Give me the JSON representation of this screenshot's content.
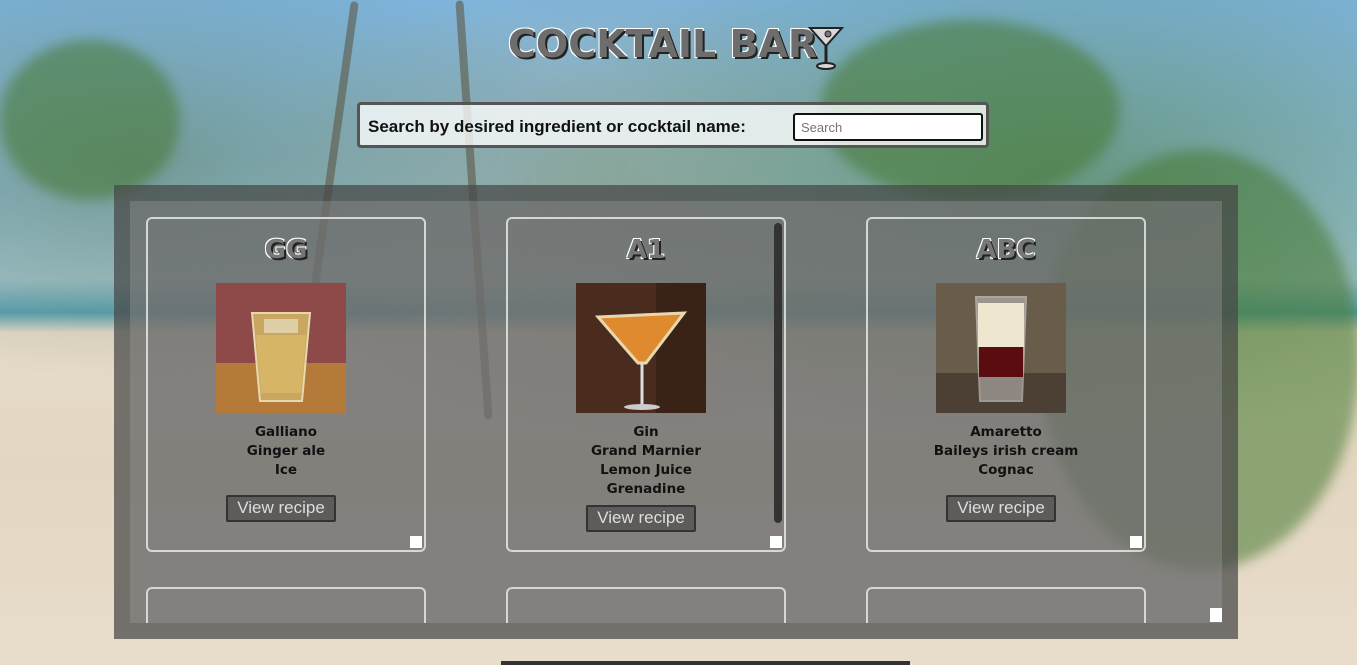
{
  "header": {
    "title": "COCKTAIL BAR"
  },
  "search": {
    "label": "Search by desired ingredient or cocktail name:",
    "placeholder": "Search"
  },
  "cocktails": [
    {
      "name": "GG",
      "ingredients": [
        "Galliano",
        "Ginger ale",
        "Ice"
      ],
      "button": "View recipe"
    },
    {
      "name": "A1",
      "ingredients": [
        "Gin",
        "Grand Marnier",
        "Lemon Juice",
        "Grenadine"
      ],
      "button": "View recipe"
    },
    {
      "name": "ABC",
      "ingredients": [
        "Amaretto",
        "Baileys irish cream",
        "Cognac"
      ],
      "button": "View recipe"
    }
  ],
  "colors": {
    "accent_scrollbar": "#35c9a9",
    "panel": "#464646"
  }
}
